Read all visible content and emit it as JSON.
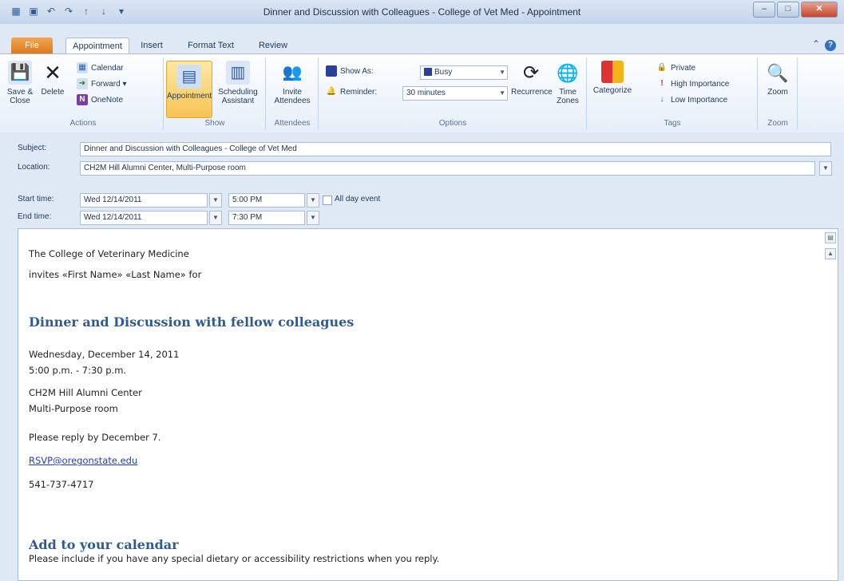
{
  "window": {
    "title": "Dinner and Discussion with Colleagues - College of Vet Med  -  Appointment",
    "qat_icons": [
      "calendar-icon",
      "save-icon",
      "undo-icon",
      "redo-icon",
      "up-arrow-icon",
      "down-arrow-icon",
      "customize-icon"
    ]
  },
  "tabs": {
    "file": "File",
    "appointment": "Appointment",
    "insert": "Insert",
    "format_text": "Format Text",
    "review": "Review"
  },
  "ribbon": {
    "actions": {
      "save_close": "Save & Close",
      "delete": "Delete",
      "calendar": "Calendar",
      "forward": "Forward",
      "onenote": "OneNote",
      "group": "Actions"
    },
    "show": {
      "appointment": "Appointment",
      "scheduling": "Scheduling Assistant",
      "group": "Show"
    },
    "attendees": {
      "invite": "Invite Attendees",
      "group": "Attendees"
    },
    "options": {
      "show_as_label": "Show As:",
      "show_as_value": "Busy",
      "reminder_label": "Reminder:",
      "reminder_value": "30 minutes",
      "recurrence": "Recurrence",
      "time_zones": "Time Zones",
      "group": "Options"
    },
    "tags": {
      "categorize": "Categorize",
      "private": "Private",
      "high": "High Importance",
      "low": "Low Importance",
      "group": "Tags"
    },
    "zoom": {
      "zoom": "Zoom",
      "group": "Zoom"
    }
  },
  "form": {
    "subject_label": "Subject:",
    "subject_value": "Dinner and Discussion with Colleagues - College of Vet Med",
    "location_label": "Location:",
    "location_value": "CH2M Hill Alumni Center, Multi-Purpose room",
    "start_label": "Start time:",
    "start_date": "Wed 12/14/2011",
    "start_time": "5:00 PM",
    "all_day": "All day event",
    "end_label": "End time:",
    "end_date": "Wed 12/14/2011",
    "end_time": "7:30 PM"
  },
  "body": {
    "line1": "The College of Veterinary Medicine",
    "line2": "invites «First Name» «Last Name» for",
    "heading1": "Dinner and Discussion with fellow colleagues",
    "date": "Wednesday, December 14, 2011",
    "time": "5:00 p.m. - 7:30 p.m.",
    "venue1": "CH2M Hill Alumni Center",
    "venue2": "Multi-Purpose room",
    "reply": "Please reply by December 7.",
    "email": "RSVP@oregonstate.edu",
    "phone": "541-737-4717",
    "heading2": "Add to your calendar",
    "note": "Please include if you have any special dietary or accessibility restrictions when you reply."
  }
}
